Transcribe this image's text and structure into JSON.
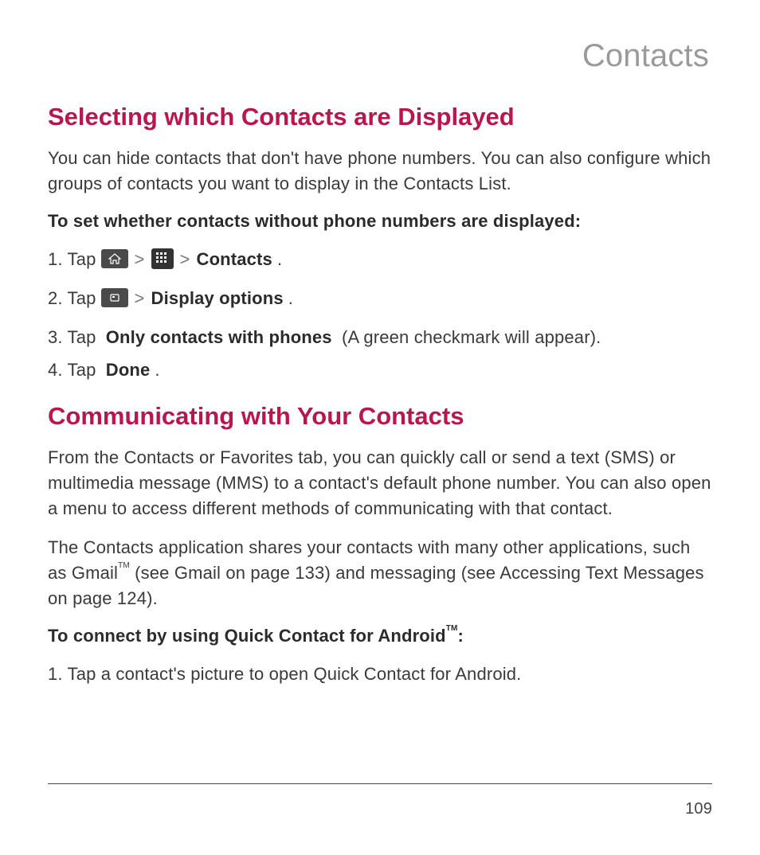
{
  "header": {
    "title": "Contacts"
  },
  "section1": {
    "heading": "Selecting which Contacts are Displayed",
    "intro": "You can hide contacts that don't have phone numbers. You can also configure which groups of contacts you want to display in the Contacts List.",
    "subhead1": "To set whether contacts without phone numbers are displayed:",
    "steps": {
      "s1_prefix": "1. Tap",
      "s1_sep1": ">",
      "s1_sep2": ">",
      "s1_bold": "Contacts",
      "s1_period": ".",
      "s2_prefix": "2. Tap",
      "s2_sep": ">",
      "s2_bold": "Display options",
      "s2_period": ".",
      "s3_prefix": "3. Tap",
      "s3_bold": "Only contacts with phones",
      "s3_suffix": " (A green checkmark will appear).",
      "s4_prefix": "4. Tap",
      "s4_bold": "Done",
      "s4_period": "."
    }
  },
  "section2": {
    "heading": "Communicating with Your Contacts",
    "p1": "From the Contacts or Favorites tab, you can quickly call or send a text (SMS) or multimedia message (MMS) to a contact's default phone number. You can also open a menu to access different methods of communicating with that contact.",
    "p2_a": "The Contacts application shares your contacts with many other applications, such as Gmail",
    "p2_tm1": "TM",
    "p2_b": " (see Gmail on page 133) and messaging (see Accessing Text Messages on page 124).",
    "subhead1_a": "To connect by using Quick Contact for Android",
    "subhead1_tm": "TM",
    "subhead1_b": ":",
    "steps": {
      "s1": "1. Tap a contact's picture to open Quick Contact for Android."
    }
  },
  "footer": {
    "page": "109"
  }
}
